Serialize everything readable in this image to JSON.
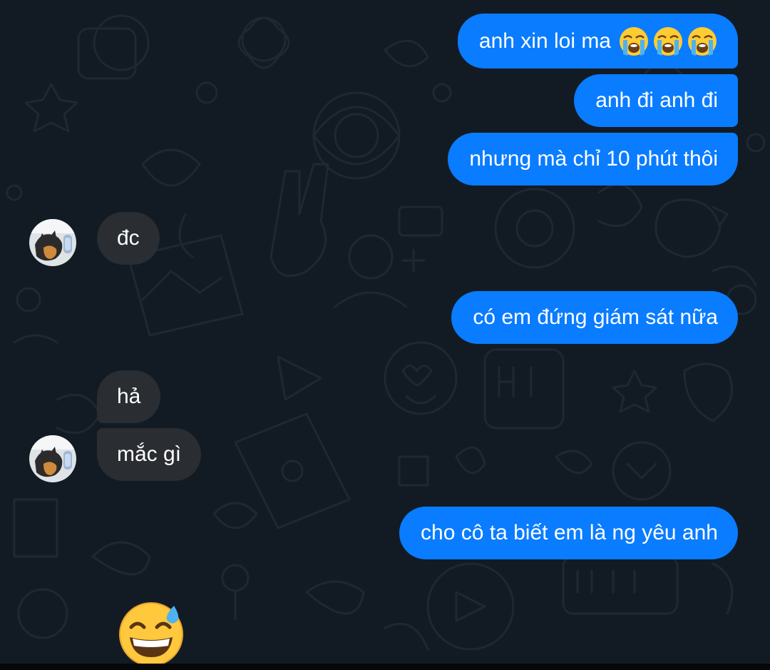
{
  "conversation": {
    "messages": [
      {
        "direction": "outgoing",
        "text": "anh xin loi ma",
        "emojis": [
          "loudly-crying-face",
          "loudly-crying-face",
          "loudly-crying-face"
        ]
      },
      {
        "direction": "outgoing",
        "text": "anh đi anh đi"
      },
      {
        "direction": "outgoing",
        "text": "nhưng mà chỉ 10 phút thôi"
      },
      {
        "direction": "incoming",
        "text": "đc"
      },
      {
        "direction": "outgoing",
        "text": "có em đứng giám sát nữa"
      },
      {
        "direction": "incoming",
        "text": "hả"
      },
      {
        "direction": "incoming",
        "text": "mắc gì"
      },
      {
        "direction": "outgoing",
        "text": "cho cô ta biết em là ng yêu anh"
      }
    ],
    "sticker_emoji": "grinning-face-with-sweat",
    "contact_avatar": "cat-avatar"
  },
  "colors": {
    "background": "#121b24",
    "outgoing_bubble": "#0a7cff",
    "incoming_bubble": "#2a2d32",
    "text": "#ffffff"
  }
}
